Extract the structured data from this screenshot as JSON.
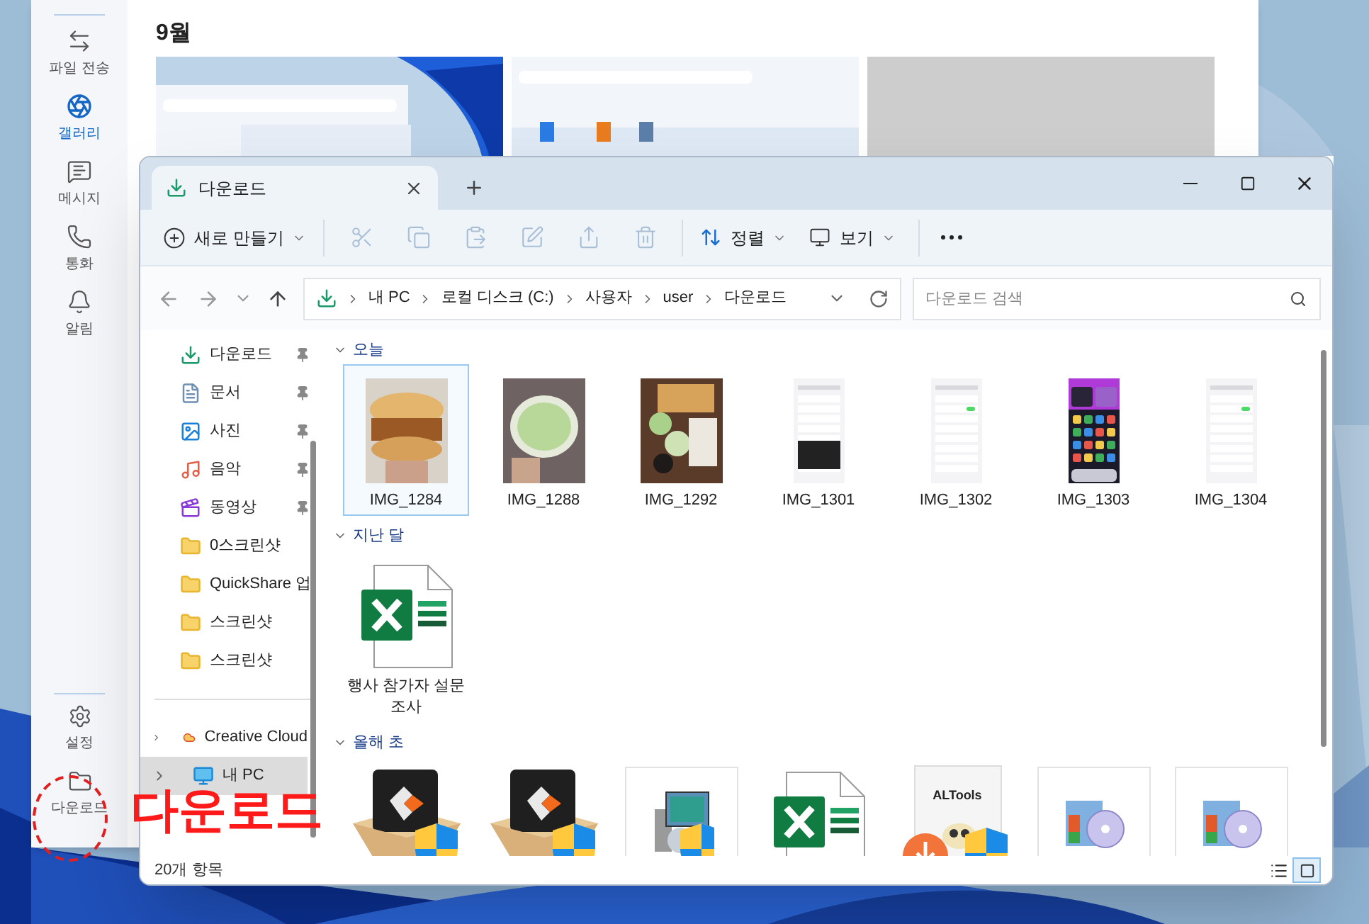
{
  "phone_link": {
    "month": "9월",
    "rail_items": [
      {
        "label": "파일 전송",
        "kind": "transfer",
        "selected": false
      },
      {
        "label": "갤러리",
        "kind": "gallery",
        "selected": true
      },
      {
        "label": "메시지",
        "kind": "message",
        "selected": false
      },
      {
        "label": "통화",
        "kind": "call",
        "selected": false
      },
      {
        "label": "알림",
        "kind": "bell",
        "selected": false
      }
    ],
    "rail_bottom": [
      {
        "label": "설정",
        "kind": "settings"
      },
      {
        "label": "다운로드",
        "kind": "folder"
      }
    ]
  },
  "explorer": {
    "tab": {
      "label": "다운로드"
    },
    "toolbar": {
      "new": "새로 만들기",
      "sort": "정렬",
      "view": "보기"
    },
    "address": {
      "segments": [
        "내 PC",
        "로컬 디스크 (C:)",
        "사용자",
        "user",
        "다운로드"
      ]
    },
    "search": {
      "placeholder": "다운로드 검색"
    },
    "nav": [
      {
        "label": "다운로드",
        "kind": "download",
        "pinned": true,
        "selected": false
      },
      {
        "label": "문서",
        "kind": "document",
        "pinned": true,
        "selected": false
      },
      {
        "label": "사진",
        "pinned": true,
        "selected": false
      },
      {
        "label": "음악",
        "kind": "music",
        "pinned": true,
        "selected": false
      },
      {
        "label": "동영상",
        "kind": "video",
        "pinned": true,
        "selected": false
      },
      {
        "label": "0스크린샷",
        "kind": "folder",
        "pinned": false,
        "selected": false
      },
      {
        "label": "QuickShare 업",
        "kind": "folder",
        "pinned": false,
        "selected": false
      },
      {
        "label": "스크린샷",
        "kind": "folder",
        "pinned": false,
        "selected": false
      },
      {
        "label": "스크린샷",
        "kind": "folder",
        "pinned": false,
        "selected": false
      }
    ],
    "tree": [
      {
        "label": "Creative Cloud",
        "kind": "cloud",
        "expanded": false,
        "selected": false
      },
      {
        "label": "내 PC",
        "kind": "pc",
        "expanded": false,
        "selected": true
      }
    ],
    "groups": [
      {
        "title": "오늘",
        "files": [
          {
            "name": "IMG_1284",
            "selected": true
          },
          {
            "name": "IMG_1288",
            "selected": false
          },
          {
            "name": "IMG_1292",
            "selected": false
          },
          {
            "name": "IMG_1301",
            "kind": "screen",
            "selected": false
          },
          {
            "name": "IMG_1302",
            "kind": "screen",
            "selected": false
          },
          {
            "name": "IMG_1303",
            "kind": "home",
            "selected": false
          },
          {
            "name": "IMG_1304",
            "kind": "screen",
            "selected": false
          }
        ]
      },
      {
        "title": "지난 달",
        "files": [
          {
            "name": "행사 참가자 설문 조사",
            "kind": "excel",
            "selected": false
          }
        ]
      },
      {
        "title": "올해 초",
        "files": [
          {
            "kind": "package",
            "selected": false
          },
          {
            "kind": "package",
            "selected": false
          },
          {
            "kind": "setup",
            "selected": false
          },
          {
            "kind": "excel",
            "selected": false
          },
          {
            "kind": "altools",
            "box_text": "ALTools",
            "selected": false
          },
          {
            "kind": "disc",
            "selected": false
          },
          {
            "kind": "disc",
            "selected": false
          }
        ]
      }
    ],
    "status": "20개 항목",
    "view_modes": [
      {
        "kind": "details",
        "selected": false
      },
      {
        "kind": "tiles",
        "selected": true
      }
    ]
  },
  "annotation": {
    "text": "다운로드"
  }
}
